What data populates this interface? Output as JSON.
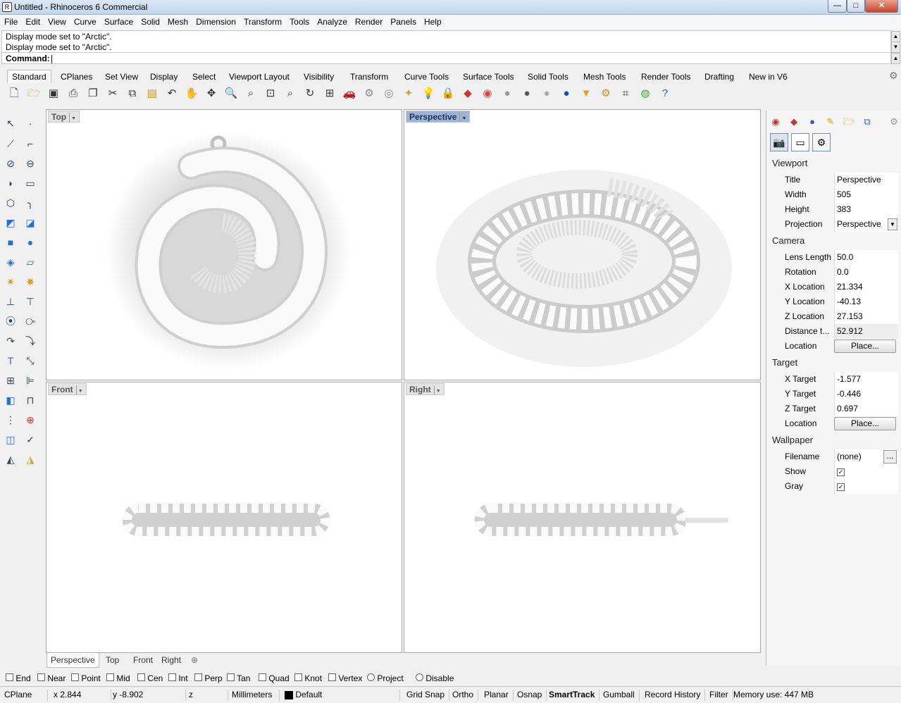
{
  "window": {
    "title": "Untitled - Rhinoceros 6 Commercial",
    "minimize": "—",
    "maximize": "□",
    "close": "✕"
  },
  "menu": [
    "File",
    "Edit",
    "View",
    "Curve",
    "Surface",
    "Solid",
    "Mesh",
    "Dimension",
    "Transform",
    "Tools",
    "Analyze",
    "Render",
    "Panels",
    "Help"
  ],
  "command": {
    "history": [
      "Display mode set to \"Arctic\".",
      "Display mode set to \"Arctic\"."
    ],
    "prompt": "Command:"
  },
  "toolbar_tabs": [
    "Standard",
    "CPlanes",
    "Set View",
    "Display",
    "Select",
    "Viewport Layout",
    "Visibility",
    "Transform",
    "Curve Tools",
    "Surface Tools",
    "Solid Tools",
    "Mesh Tools",
    "Render Tools",
    "Drafting",
    "New in V6"
  ],
  "toolbar_icons": [
    "new-file",
    "open-file",
    "save",
    "print",
    "import",
    "cut",
    "copy",
    "paste",
    "undo",
    "pan",
    "rotate-view",
    "zoom",
    "zoom-window",
    "zoom-extents",
    "zoom-selected",
    "rotate-view-2",
    "four-viewports",
    "car-render",
    "properties",
    "object-snap",
    "light",
    "lock",
    "layer",
    "color-wheel",
    "shaded-sphere",
    "rendered-sphere",
    "glass-sphere",
    "blue-sphere",
    "filter",
    "settings",
    "grid-snap",
    "globe",
    "help"
  ],
  "viewports": {
    "top": "Top",
    "perspective": "Perspective",
    "front": "Front",
    "right": "Right"
  },
  "viewport_tabs": [
    "Perspective",
    "Top",
    "Front",
    "Right"
  ],
  "panel": {
    "viewport_header": "Viewport",
    "viewport": [
      {
        "label": "Title",
        "value": "Perspective"
      },
      {
        "label": "Width",
        "value": "505"
      },
      {
        "label": "Height",
        "value": "383"
      },
      {
        "label": "Projection",
        "value": "Perspective"
      }
    ],
    "camera_header": "Camera",
    "camera": [
      {
        "label": "Lens Length",
        "value": "50.0"
      },
      {
        "label": "Rotation",
        "value": "0.0"
      },
      {
        "label": "X Location",
        "value": "21.334"
      },
      {
        "label": "Y Location",
        "value": "-40.13"
      },
      {
        "label": "Z Location",
        "value": "27.153"
      },
      {
        "label": "Distance t...",
        "value": "52.912"
      },
      {
        "label": "Location",
        "button": "Place..."
      }
    ],
    "target_header": "Target",
    "target": [
      {
        "label": "X Target",
        "value": "-1.577"
      },
      {
        "label": "Y Target",
        "value": "-0.446"
      },
      {
        "label": "Z Target",
        "value": "0.697"
      },
      {
        "label": "Location",
        "button": "Place..."
      }
    ],
    "wallpaper_header": "Wallpaper",
    "wallpaper": [
      {
        "label": "Filename",
        "value": "(none)",
        "button": "..."
      },
      {
        "label": "Show",
        "checked": true
      },
      {
        "label": "Gray",
        "checked": true
      }
    ]
  },
  "osnaps": [
    "End",
    "Near",
    "Point",
    "Mid",
    "Cen",
    "Int",
    "Perp",
    "Tan",
    "Quad",
    "Knot",
    "Vertex",
    "Project",
    "Disable"
  ],
  "status": {
    "cplane": "CPlane",
    "x": "x 2.844",
    "y": "y -8.902",
    "z": "z",
    "units": "Millimeters",
    "layer": "Default",
    "grid_snap": "Grid Snap",
    "ortho": "Ortho",
    "planar": "Planar",
    "osnap": "Osnap",
    "smarttrack": "SmartTrack",
    "gumball": "Gumball",
    "record_history": "Record History",
    "filter": "Filter",
    "memory": "Memory use: 447 MB"
  }
}
